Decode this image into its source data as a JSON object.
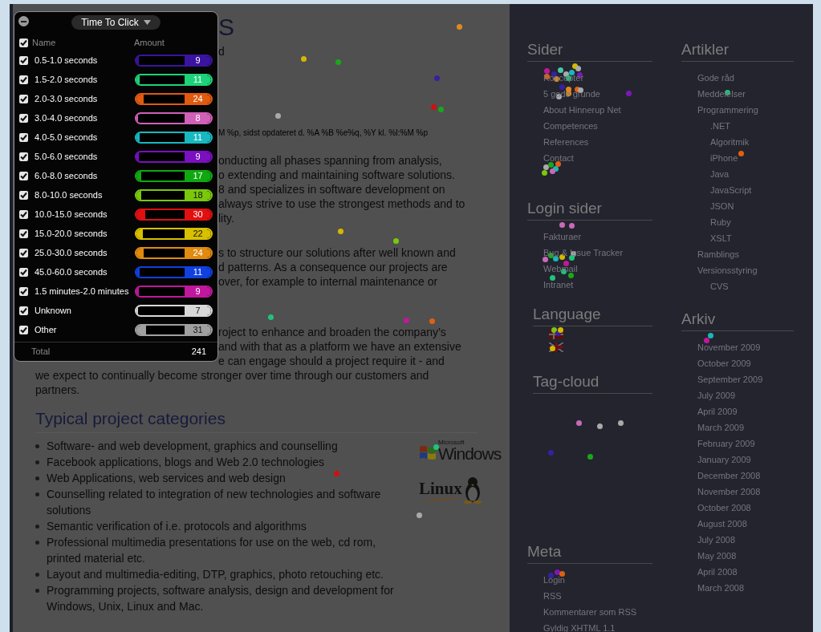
{
  "page": {
    "heading_fragment": "S",
    "subtitle_fragment": "d",
    "date_fragment": "M %p, sidst opdateret d. %A %B %e%q, %Y kl. %I:%M %p",
    "paragraph_fragments": [
      [
        "onducting all phases spanning from analysis,",
        "o extending and maintaining software solutions.",
        "8 and specializes in software development on",
        "always strive to use the strongest methods and to",
        "lity."
      ],
      [
        "s to structure our solutions after well known and",
        "d patterns. As a consequence our projects are",
        "over, for example to internal maintenance or"
      ],
      [
        "roject to enhance and broaden the company’s",
        "and with that as a platform we have an extensive",
        "e can engage should  a project require it - and"
      ]
    ],
    "paragraph_tail": [
      "we expect to continually become stronger over time through our customers and",
      "partners."
    ],
    "section_title": "Typical project categories",
    "categories": [
      "Software- and web development, graphics and counselling",
      "Facebook applications, blogs and Web 2.0 technologies",
      "Web Applications, web services and web design",
      "Counselling related to integration of new technologies and software solutions",
      "Semantic verification of i.e. protocols and algorithms",
      "Professional multimedia presentations for use on the web, cd rom, printed material etc.",
      "Layout and multimedia-editing, DTP, graphics, photo retouching etc.",
      "Programming projects, software analysis, design and development for Windows, Unix, Linux and Mac."
    ],
    "logos": [
      {
        "kind": "windows",
        "small": "Microsoft",
        "text": "Windows"
      },
      {
        "kind": "linux",
        "text": "Linux"
      }
    ]
  },
  "sidebar": {
    "left": [
      {
        "title": "Sider",
        "items": [
          {
            "label": "Koncepter"
          },
          {
            "label": "5 gode grunde"
          },
          {
            "label": "About Hinnerup Net"
          },
          {
            "label": "Competences"
          },
          {
            "label": "References"
          },
          {
            "label": "Contact"
          }
        ]
      },
      {
        "title": "Login sider",
        "items": [
          {
            "label": "Fakturaer"
          },
          {
            "label": "Bug & Issue Tracker"
          },
          {
            "label": "Webmail"
          },
          {
            "label": "Intranet"
          }
        ]
      },
      {
        "title": "Language"
      },
      {
        "title": "Tag-cloud"
      },
      {
        "title": "Meta",
        "items": [
          {
            "label": "Login"
          },
          {
            "label": "RSS"
          },
          {
            "label": "Kommentarer som RSS"
          },
          {
            "label": "Gyldig XHTML 1.1"
          }
        ]
      }
    ],
    "right": [
      {
        "title": "Artikler",
        "items": [
          {
            "label": "Gode råd"
          },
          {
            "label": "Meddelelser"
          },
          {
            "label": "Programmering",
            "children": [
              {
                "label": ".NET"
              },
              {
                "label": "Algoritmik"
              },
              {
                "label": "iPhone"
              },
              {
                "label": "Java"
              },
              {
                "label": "JavaScript"
              },
              {
                "label": "JSON"
              },
              {
                "label": "Ruby"
              },
              {
                "label": "XSLT"
              }
            ]
          },
          {
            "label": "Ramblings"
          },
          {
            "label": "Versionsstyring",
            "children": [
              {
                "label": "CVS"
              }
            ]
          }
        ]
      },
      {
        "title": "Arkiv",
        "items": [
          {
            "label": "November 2009"
          },
          {
            "label": "October 2009"
          },
          {
            "label": "September 2009"
          },
          {
            "label": "July 2009"
          },
          {
            "label": "April 2009"
          },
          {
            "label": "March 2009"
          },
          {
            "label": "February 2009"
          },
          {
            "label": "January 2009"
          },
          {
            "label": "December 2008"
          },
          {
            "label": "November 2008"
          },
          {
            "label": "October 2008"
          },
          {
            "label": "August 2008"
          },
          {
            "label": "July 2008"
          },
          {
            "label": "May 2008"
          },
          {
            "label": "April 2008"
          },
          {
            "label": "March 2008"
          }
        ]
      }
    ]
  },
  "panel": {
    "title": "Time To Click",
    "header": {
      "checked": true,
      "name": "Name",
      "amount": "Amount"
    },
    "rows": [
      {
        "label": "0.5-1.0 seconds",
        "value": "9",
        "color": "#3a14a0",
        "level": 0.04,
        "checked": true
      },
      {
        "label": "1.5-2.0 seconds",
        "value": "11",
        "color": "#1ed27a",
        "level": 0.05,
        "checked": true
      },
      {
        "label": "2.0-3.0 seconds",
        "value": "24",
        "color": "#e05a10",
        "level": 0.1,
        "checked": true
      },
      {
        "label": "3.0-4.0 seconds",
        "value": "8",
        "color": "#d060b8",
        "level": 0.03,
        "checked": true
      },
      {
        "label": "4.0-5.0 seconds",
        "value": "11",
        "color": "#18b8c0",
        "level": 0.05,
        "checked": true
      },
      {
        "label": "5.0-6.0 seconds",
        "value": "9",
        "color": "#7a10c0",
        "level": 0.04,
        "checked": true
      },
      {
        "label": "6.0-8.0 seconds",
        "value": "17",
        "color": "#10a810",
        "level": 0.07,
        "checked": true
      },
      {
        "label": "8.0-10.0 seconds",
        "value": "18",
        "color": "#7ac80c",
        "level": 0.07,
        "checked": true
      },
      {
        "label": "10.0-15.0 seconds",
        "value": "30",
        "color": "#e01010",
        "level": 0.12,
        "checked": true
      },
      {
        "label": "15.0-20.0 seconds",
        "value": "22",
        "color": "#d8c000",
        "level": 0.09,
        "checked": true
      },
      {
        "label": "25.0-30.0 seconds",
        "value": "24",
        "color": "#e08a10",
        "level": 0.1,
        "checked": true
      },
      {
        "label": "45.0-60.0 seconds",
        "value": "11",
        "color": "#1040e0",
        "level": 0.05,
        "checked": true
      },
      {
        "label": "1.5 minutes-2.0 minutes",
        "value": "9",
        "color": "#c0189c",
        "level": 0.04,
        "checked": true
      },
      {
        "label": "Unknown",
        "value": "7",
        "color": "#d8d8d8",
        "level": 0.03,
        "checked": true
      },
      {
        "label": "Other",
        "value": "31",
        "color": "#a0a0a0",
        "level": 0.13,
        "checked": true
      }
    ],
    "total_label": "Total",
    "total": "241"
  }
}
